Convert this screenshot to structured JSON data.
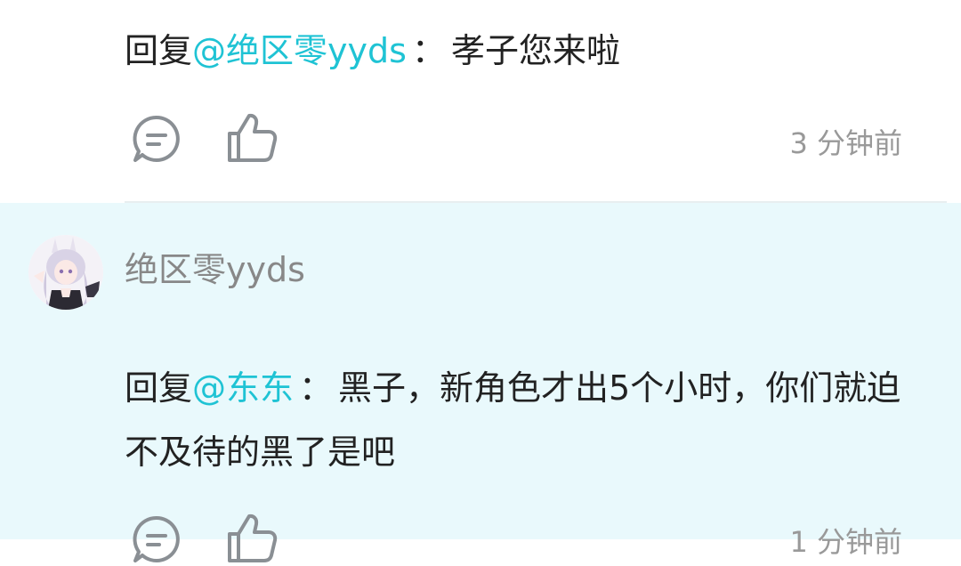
{
  "comment1": {
    "reply_prefix": "回复",
    "mention": "@绝区零yyds",
    "colon": "：",
    "text": "孝子您来啦",
    "time": "3 分钟前"
  },
  "comment2": {
    "username": "绝区零yyds",
    "reply_prefix": "回复",
    "mention": "@东东",
    "colon": "：",
    "text": "黑子，新角色才出5个小时，你们就迫不及待的黑了是吧",
    "time": "1 分钟前"
  },
  "icons": {
    "comment": "comment-icon",
    "like": "thumbs-up-icon",
    "avatar": "anime-avatar"
  },
  "colors": {
    "mention": "#1fc3d4",
    "highlight_bg": "#e9f9fc",
    "icon_gray": "#8a8f94",
    "time_gray": "#999999"
  }
}
